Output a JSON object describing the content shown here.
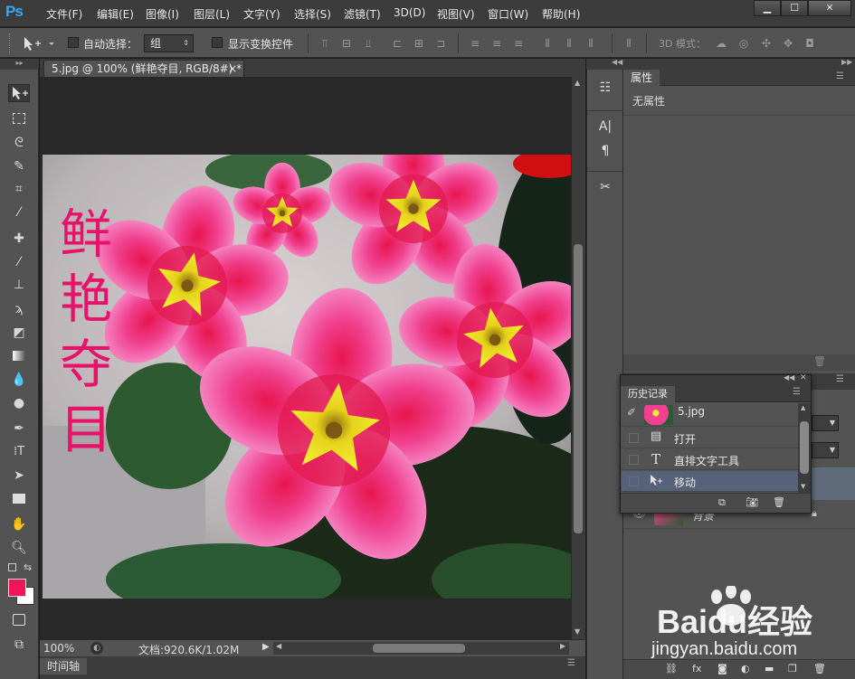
{
  "app": {
    "logo": "Ps"
  },
  "menu": [
    "文件(F)",
    "编辑(E)",
    "图像(I)",
    "图层(L)",
    "文字(Y)",
    "选择(S)",
    "滤镜(T)",
    "3D(D)",
    "视图(V)",
    "窗口(W)",
    "帮助(H)"
  ],
  "window_controls": {
    "minimize": "▁",
    "maximize": "☐",
    "close": "✕"
  },
  "options": {
    "auto_select_label": "自动选择：",
    "auto_select_value": "组",
    "show_transform_label": "显示变换控件",
    "mode_3d_label": "3D 模式："
  },
  "document": {
    "tab_title": "5.jpg @ 100% (鲜艳夺目, RGB/8#) *",
    "tab_close": "×",
    "overlay_text": [
      "鲜",
      "艳",
      "夺",
      "目"
    ]
  },
  "status": {
    "zoom": "100%",
    "doc_size": "文档:920.6K/1.02M"
  },
  "timeline_label": "时间轴",
  "properties_panel": {
    "tab": "属性",
    "content": "无属性"
  },
  "history_panel": {
    "tab": "历史记录",
    "snapshot_name": "5.jpg",
    "items": [
      {
        "label": "打开",
        "icon": "document-icon"
      },
      {
        "label": "直排文字工具",
        "icon": "type-icon"
      },
      {
        "label": "移动",
        "icon": "move-icon"
      }
    ]
  },
  "layers_partial": {
    "layer_name": "背景"
  },
  "watermark": {
    "brand": "Baidu经验",
    "url": "jingyan.baidu.com"
  },
  "colors": {
    "foreground": "#f0145a",
    "background": "#ffffff",
    "accent": "#31a8ff",
    "overlay_text": "#e8126b"
  }
}
